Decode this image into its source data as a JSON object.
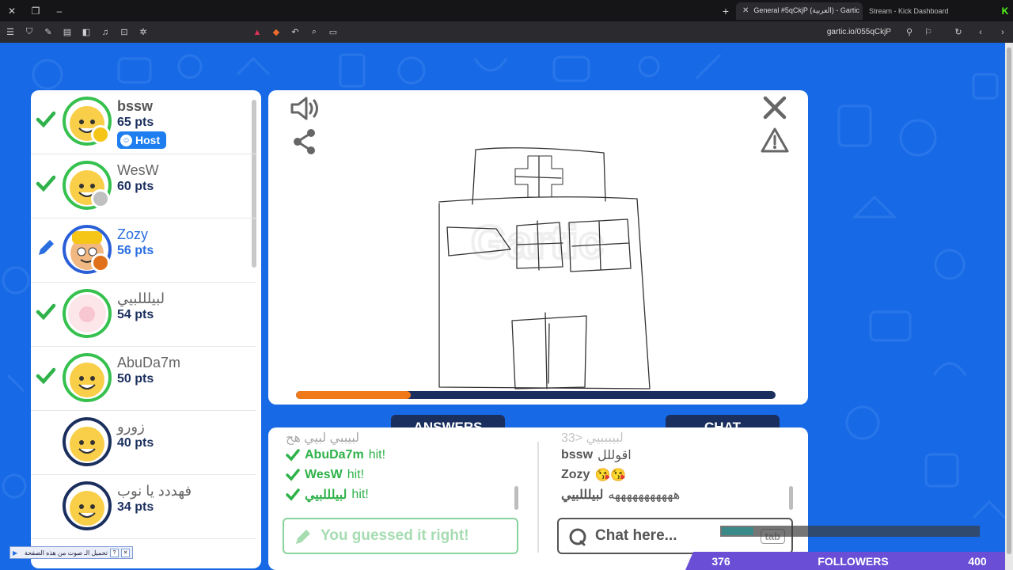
{
  "browser": {
    "tabs": [
      {
        "title": "General #5qCkjP (العربية) - Gartic",
        "active": true
      },
      {
        "title": "Stream - Kick Dashboard",
        "active": false
      }
    ],
    "url": "gartic.io/055qCkjP"
  },
  "players": [
    {
      "name": "bssw",
      "points": "65 pts",
      "status": "guessed",
      "badge_color": "#f5c518",
      "host_label": "Host"
    },
    {
      "name": "WesW",
      "points": "60 pts",
      "status": "guessed",
      "badge_color": "#c0c0c0"
    },
    {
      "name": "Zozy",
      "points": "56 pts",
      "status": "drawing",
      "badge_color": "#e0701a"
    },
    {
      "name": "لبيلللبيي",
      "points": "54 pts",
      "status": "guessed"
    },
    {
      "name": "AbuDa7m",
      "points": "50 pts",
      "status": "guessed"
    },
    {
      "name": "زورو",
      "points": "40 pts",
      "status": "none"
    },
    {
      "name": "فهددد يا نوب",
      "points": "34 pts",
      "status": "none"
    }
  ],
  "canvas": {
    "progress_percent": 24,
    "watermark": "Gartic"
  },
  "answers": {
    "tab_label": "ANSWERS",
    "faded_line": "لبيببي لبيي هح",
    "entries": [
      {
        "name": "AbuDa7m",
        "text": "hit!"
      },
      {
        "name": "WesW",
        "text": "hit!"
      },
      {
        "name": "لبيلللبيي",
        "text": "hit!"
      }
    ],
    "input_placeholder": "You guessed it right!"
  },
  "chat": {
    "tab_label": "CHAT",
    "faded_line": "لبيبببيي <33",
    "messages": [
      {
        "name": "bssw",
        "text": "اقوللل"
      },
      {
        "name": "Zozy",
        "text": "😘😘"
      },
      {
        "name": "لبيلللبيي",
        "text": "هههههههههههه"
      }
    ],
    "input_placeholder": "Chat here...",
    "tab_key": "tab"
  },
  "overlays": {
    "translate_text": "تحميل الـ صوت من هذه الصفحة",
    "followers_count_left": "376",
    "followers_label": "FOLLOWERS",
    "followers_count_right": "400"
  },
  "colors": {
    "page_bg": "#1769e6",
    "navy": "#1b2f5e",
    "green": "#36c14e",
    "orange": "#f07a1a"
  }
}
